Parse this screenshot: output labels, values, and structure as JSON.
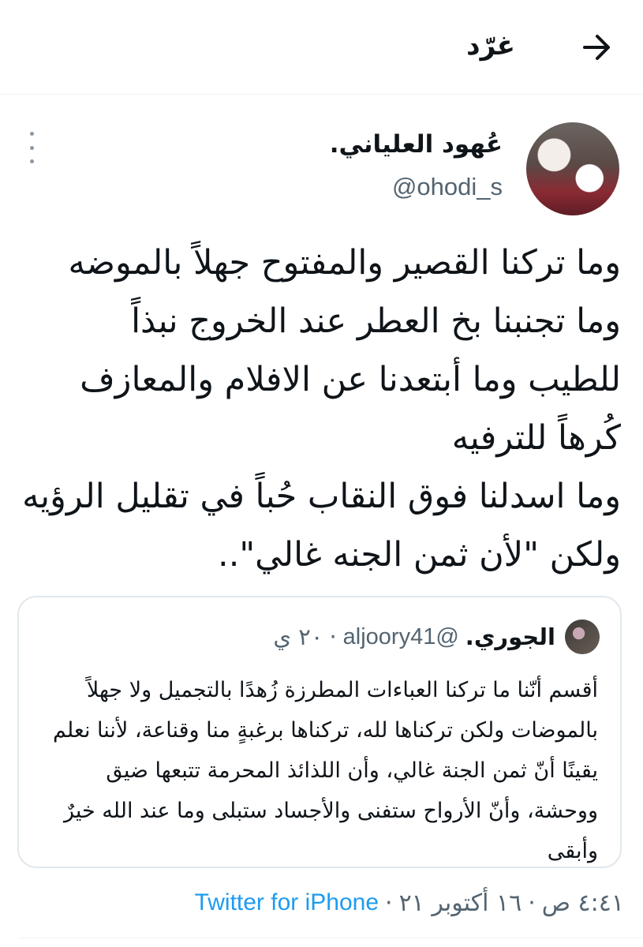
{
  "header": {
    "title": "غرّد",
    "back_icon": "arrow-right-icon"
  },
  "author": {
    "display_name": "عُهود العلياني.",
    "handle": "@ohodi_s",
    "more_icon": "more-vertical-icon"
  },
  "tweet": {
    "text": "وما تركنا القصير والمفتوح جهلاً بالموضه\nوما تجنبنا بخ العطر عند الخروج نبذاً\nللطيب  وما أبتعدنا عن الافلام والمعازف\nكُرهاً للترفيه\nوما اسدلنا فوق النقاب حُباً في تقليل الرؤيه\nولكن \"لأن ثمن الجنه غالي\".."
  },
  "quoted_tweet": {
    "name": "الجوري.",
    "handle": "@aljoory41",
    "separator": "·",
    "time": "٢٠ ي",
    "text": "أقسم أنّنا ما تركنا العباءات المطرزة زُهدًا بالتجميل ولا جهلاً بالموضات ولكن تركناها لله، تركناها برغبةٍ منا وقناعة، لأننا نعلم يقينًا أنّ ثمن الجنة غالي، وأن اللذائذ المحرمة تتبعها ضيق ووحشة، وأنّ الأرواح ستفنى والأجساد ستبلى وما عند الله خيرٌ وأبقى"
  },
  "meta": {
    "time": "٤:٤١ ص",
    "separator": "·",
    "date": "١٦ أكتوبر ٢١",
    "source": "Twitter for iPhone"
  },
  "colors": {
    "link": "#1d9bf0",
    "secondary_text": "#536471",
    "primary_text": "#0f1419"
  }
}
